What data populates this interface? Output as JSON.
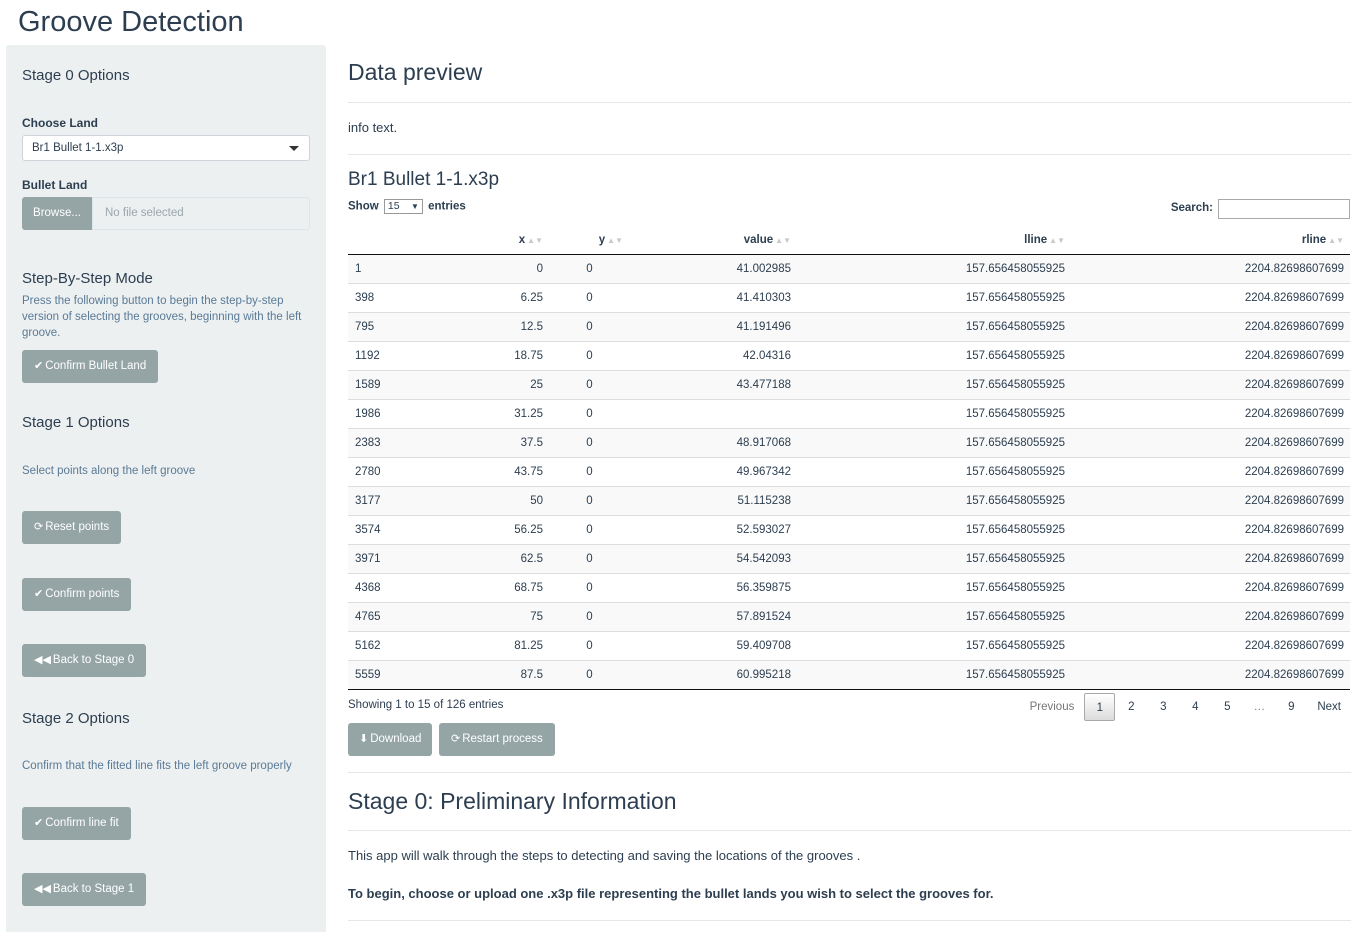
{
  "app": {
    "title": "Groove Detection"
  },
  "sidebar": {
    "stage0_heading": "Stage 0 Options",
    "choose_land_label": "Choose Land",
    "choose_land_value": "Br1 Bullet 1-1.x3p",
    "bullet_land_label": "Bullet Land",
    "browse_label": "Browse...",
    "file_placeholder": "No file selected",
    "step_heading": "Step-By-Step Mode",
    "step_help": "Press the following button to begin the step-by-step version of selecting the grooves, beginning with the left groove.",
    "confirm_land_label": "Confirm Bullet Land",
    "stage1_heading": "Stage 1 Options",
    "stage1_help": "Select points along the left groove",
    "reset_label": "Reset points",
    "confirm_points_label": "Confirm points",
    "back_stage0_label": "Back to Stage 0",
    "stage2_heading": "Stage 2 Options",
    "stage2_help": "Confirm that the fitted line fits the left groove properly",
    "confirm_fit_label": "Confirm line fit",
    "back_stage1_label": "Back to Stage 1"
  },
  "main": {
    "preview_heading": "Data preview",
    "info_text": "info text.",
    "dataset_title": "Br1 Bullet 1-1.x3p",
    "show_label": "Show",
    "entries_label": "entries",
    "page_length": "15",
    "search_label": "Search:",
    "columns": [
      "",
      "x",
      "y",
      "value",
      "lline",
      "rline"
    ],
    "rows": [
      [
        "1",
        "0",
        "0",
        "41.002985",
        "157.656458055925",
        "2204.82698607699"
      ],
      [
        "398",
        "6.25",
        "0",
        "41.410303",
        "157.656458055925",
        "2204.82698607699"
      ],
      [
        "795",
        "12.5",
        "0",
        "41.191496",
        "157.656458055925",
        "2204.82698607699"
      ],
      [
        "1192",
        "18.75",
        "0",
        "42.04316",
        "157.656458055925",
        "2204.82698607699"
      ],
      [
        "1589",
        "25",
        "0",
        "43.477188",
        "157.656458055925",
        "2204.82698607699"
      ],
      [
        "1986",
        "31.25",
        "0",
        "",
        "157.656458055925",
        "2204.82698607699"
      ],
      [
        "2383",
        "37.5",
        "0",
        "48.917068",
        "157.656458055925",
        "2204.82698607699"
      ],
      [
        "2780",
        "43.75",
        "0",
        "49.967342",
        "157.656458055925",
        "2204.82698607699"
      ],
      [
        "3177",
        "50",
        "0",
        "51.115238",
        "157.656458055925",
        "2204.82698607699"
      ],
      [
        "3574",
        "56.25",
        "0",
        "52.593027",
        "157.656458055925",
        "2204.82698607699"
      ],
      [
        "3971",
        "62.5",
        "0",
        "54.542093",
        "157.656458055925",
        "2204.82698607699"
      ],
      [
        "4368",
        "68.75",
        "0",
        "56.359875",
        "157.656458055925",
        "2204.82698607699"
      ],
      [
        "4765",
        "75",
        "0",
        "57.891524",
        "157.656458055925",
        "2204.82698607699"
      ],
      [
        "5162",
        "81.25",
        "0",
        "59.409708",
        "157.656458055925",
        "2204.82698607699"
      ],
      [
        "5559",
        "87.5",
        "0",
        "60.995218",
        "157.656458055925",
        "2204.82698607699"
      ]
    ],
    "info_footer": "Showing 1 to 15 of 126 entries",
    "pagination": {
      "previous": "Previous",
      "pages": [
        "1",
        "2",
        "3",
        "4",
        "5",
        "…",
        "9"
      ],
      "current": "1",
      "next": "Next"
    },
    "download_label": "Download",
    "restart_label": "Restart process",
    "stage0_heading": "Stage 0: Preliminary Information",
    "stage0_text": "This app will walk through the steps to detecting and saving the locations of the grooves .",
    "stage0_bold": "To begin, choose or upload one .x3p file representing the bullet lands you wish to select the grooves for."
  }
}
